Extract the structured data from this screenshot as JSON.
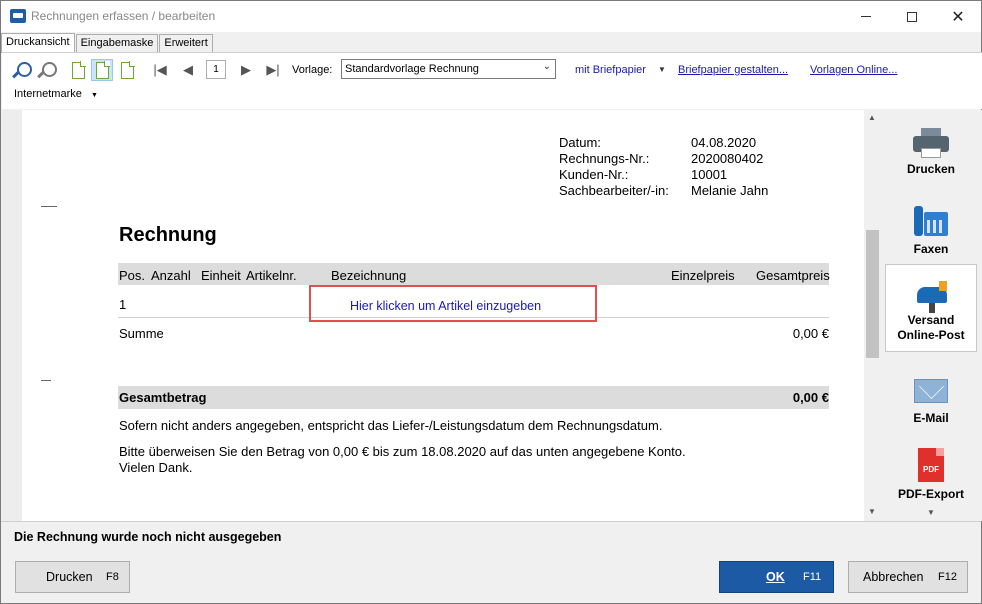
{
  "window": {
    "title": "Rechnungen erfassen / bearbeiten",
    "minimize": "",
    "maximize": "",
    "close": "✕"
  },
  "tabs": [
    {
      "label": "Druckansicht",
      "active": true
    },
    {
      "label": "Eingabemaske",
      "active": false
    },
    {
      "label": "Erweitert",
      "active": false
    }
  ],
  "toolbar": {
    "page_number": "1",
    "vorlage_label": "Vorlage:",
    "vorlage_value": "Standardvorlage Rechnung",
    "briefpapier_option": "mit Briefpapier",
    "briefpapier_link": "Briefpapier gestalten...",
    "vorlagen_link": "Vorlagen Online...",
    "internetmarke": "Internetmarke",
    "icons": [
      "zoom-out-icon",
      "zoom-in-icon",
      "page-single-icon",
      "page-width-icon",
      "page-full-icon",
      "first-page-icon",
      "previous-page-icon",
      "next-page-icon",
      "last-page-icon"
    ]
  },
  "document": {
    "meta": [
      {
        "key": "Datum:",
        "value": "04.08.2020"
      },
      {
        "key": "Rechnungs-Nr.:",
        "value": "2020080402"
      },
      {
        "key": "Kunden-Nr.:",
        "value": "10001"
      },
      {
        "key": "Sachbearbeiter/-in:",
        "value": "Melanie Jahn"
      }
    ],
    "heading": "Rechnung",
    "columns": [
      "Pos.",
      "Anzahl",
      "Einheit",
      "Artikelnr.",
      "Bezeichnung",
      "Einzelpreis",
      "Gesamtpreis"
    ],
    "row_pos": "1",
    "article_link": "Hier klicken um Artikel einzugeben",
    "summe_label": "Summe",
    "summe_value": "0,00 €",
    "gesamt_label": "Gesamtbetrag",
    "gesamt_value": "0,00 €",
    "text1": "Sofern nicht anders angegeben, entspricht das Liefer-/Leistungsdatum dem Rechnungsdatum.",
    "text2": "Bitte überweisen Sie den Betrag von 0,00 € bis zum 18.08.2020 auf das unten angegebene Konto.",
    "text3": "Vielen Dank."
  },
  "actions": [
    {
      "label": "Drucken",
      "icon": "printer-icon"
    },
    {
      "label": "Faxen",
      "icon": "fax-icon"
    },
    {
      "label": "Versand Online-Post",
      "icon": "mailbox-icon",
      "selected": true
    },
    {
      "label": "E-Mail",
      "icon": "envelope-icon"
    },
    {
      "label": "PDF-Export",
      "icon": "pdf-icon",
      "icon_text": "PDF"
    }
  ],
  "status": "Die Rechnung wurde noch nicht ausgegeben",
  "buttons": {
    "drucken_label": "Drucken",
    "drucken_key": "F8",
    "ok_label": "OK",
    "ok_key": "F11",
    "abbrechen_label": "Abbrechen",
    "abbrechen_key": "F12"
  },
  "colors": {
    "accent": "#1d5aa6",
    "link": "#1a1ab0",
    "highlight_border": "#e05050",
    "table_header": "#dcdcdc"
  }
}
